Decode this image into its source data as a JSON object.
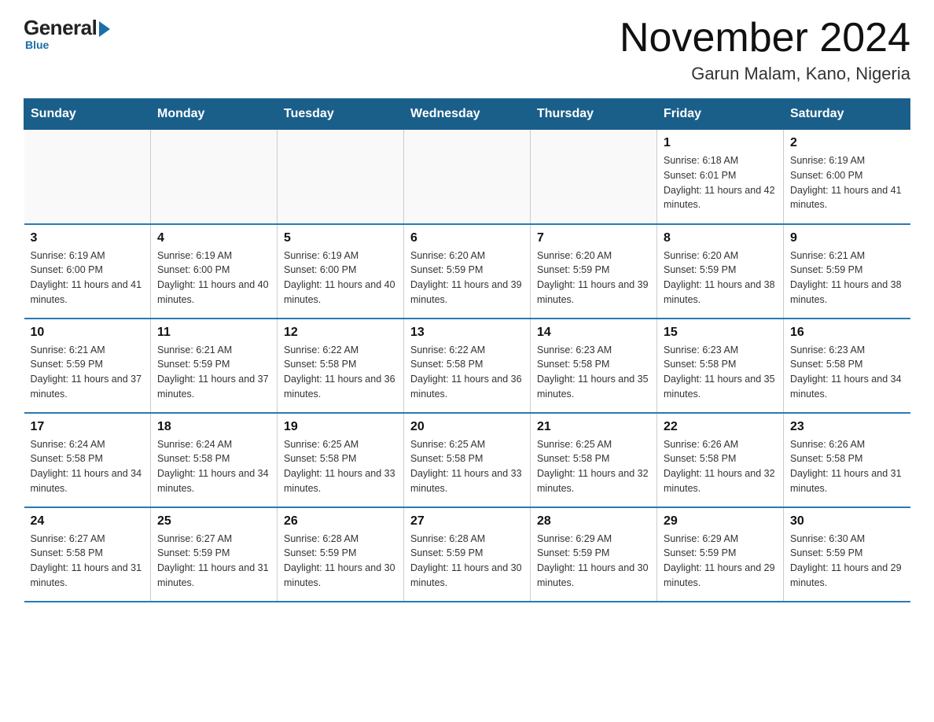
{
  "logo": {
    "general": "General",
    "blue": "Blue"
  },
  "title": "November 2024",
  "subtitle": "Garun Malam, Kano, Nigeria",
  "days_of_week": [
    "Sunday",
    "Monday",
    "Tuesday",
    "Wednesday",
    "Thursday",
    "Friday",
    "Saturday"
  ],
  "weeks": [
    [
      {
        "day": "",
        "info": ""
      },
      {
        "day": "",
        "info": ""
      },
      {
        "day": "",
        "info": ""
      },
      {
        "day": "",
        "info": ""
      },
      {
        "day": "",
        "info": ""
      },
      {
        "day": "1",
        "info": "Sunrise: 6:18 AM\nSunset: 6:01 PM\nDaylight: 11 hours and 42 minutes."
      },
      {
        "day": "2",
        "info": "Sunrise: 6:19 AM\nSunset: 6:00 PM\nDaylight: 11 hours and 41 minutes."
      }
    ],
    [
      {
        "day": "3",
        "info": "Sunrise: 6:19 AM\nSunset: 6:00 PM\nDaylight: 11 hours and 41 minutes."
      },
      {
        "day": "4",
        "info": "Sunrise: 6:19 AM\nSunset: 6:00 PM\nDaylight: 11 hours and 40 minutes."
      },
      {
        "day": "5",
        "info": "Sunrise: 6:19 AM\nSunset: 6:00 PM\nDaylight: 11 hours and 40 minutes."
      },
      {
        "day": "6",
        "info": "Sunrise: 6:20 AM\nSunset: 5:59 PM\nDaylight: 11 hours and 39 minutes."
      },
      {
        "day": "7",
        "info": "Sunrise: 6:20 AM\nSunset: 5:59 PM\nDaylight: 11 hours and 39 minutes."
      },
      {
        "day": "8",
        "info": "Sunrise: 6:20 AM\nSunset: 5:59 PM\nDaylight: 11 hours and 38 minutes."
      },
      {
        "day": "9",
        "info": "Sunrise: 6:21 AM\nSunset: 5:59 PM\nDaylight: 11 hours and 38 minutes."
      }
    ],
    [
      {
        "day": "10",
        "info": "Sunrise: 6:21 AM\nSunset: 5:59 PM\nDaylight: 11 hours and 37 minutes."
      },
      {
        "day": "11",
        "info": "Sunrise: 6:21 AM\nSunset: 5:59 PM\nDaylight: 11 hours and 37 minutes."
      },
      {
        "day": "12",
        "info": "Sunrise: 6:22 AM\nSunset: 5:58 PM\nDaylight: 11 hours and 36 minutes."
      },
      {
        "day": "13",
        "info": "Sunrise: 6:22 AM\nSunset: 5:58 PM\nDaylight: 11 hours and 36 minutes."
      },
      {
        "day": "14",
        "info": "Sunrise: 6:23 AM\nSunset: 5:58 PM\nDaylight: 11 hours and 35 minutes."
      },
      {
        "day": "15",
        "info": "Sunrise: 6:23 AM\nSunset: 5:58 PM\nDaylight: 11 hours and 35 minutes."
      },
      {
        "day": "16",
        "info": "Sunrise: 6:23 AM\nSunset: 5:58 PM\nDaylight: 11 hours and 34 minutes."
      }
    ],
    [
      {
        "day": "17",
        "info": "Sunrise: 6:24 AM\nSunset: 5:58 PM\nDaylight: 11 hours and 34 minutes."
      },
      {
        "day": "18",
        "info": "Sunrise: 6:24 AM\nSunset: 5:58 PM\nDaylight: 11 hours and 34 minutes."
      },
      {
        "day": "19",
        "info": "Sunrise: 6:25 AM\nSunset: 5:58 PM\nDaylight: 11 hours and 33 minutes."
      },
      {
        "day": "20",
        "info": "Sunrise: 6:25 AM\nSunset: 5:58 PM\nDaylight: 11 hours and 33 minutes."
      },
      {
        "day": "21",
        "info": "Sunrise: 6:25 AM\nSunset: 5:58 PM\nDaylight: 11 hours and 32 minutes."
      },
      {
        "day": "22",
        "info": "Sunrise: 6:26 AM\nSunset: 5:58 PM\nDaylight: 11 hours and 32 minutes."
      },
      {
        "day": "23",
        "info": "Sunrise: 6:26 AM\nSunset: 5:58 PM\nDaylight: 11 hours and 31 minutes."
      }
    ],
    [
      {
        "day": "24",
        "info": "Sunrise: 6:27 AM\nSunset: 5:58 PM\nDaylight: 11 hours and 31 minutes."
      },
      {
        "day": "25",
        "info": "Sunrise: 6:27 AM\nSunset: 5:59 PM\nDaylight: 11 hours and 31 minutes."
      },
      {
        "day": "26",
        "info": "Sunrise: 6:28 AM\nSunset: 5:59 PM\nDaylight: 11 hours and 30 minutes."
      },
      {
        "day": "27",
        "info": "Sunrise: 6:28 AM\nSunset: 5:59 PM\nDaylight: 11 hours and 30 minutes."
      },
      {
        "day": "28",
        "info": "Sunrise: 6:29 AM\nSunset: 5:59 PM\nDaylight: 11 hours and 30 minutes."
      },
      {
        "day": "29",
        "info": "Sunrise: 6:29 AM\nSunset: 5:59 PM\nDaylight: 11 hours and 29 minutes."
      },
      {
        "day": "30",
        "info": "Sunrise: 6:30 AM\nSunset: 5:59 PM\nDaylight: 11 hours and 29 minutes."
      }
    ]
  ]
}
